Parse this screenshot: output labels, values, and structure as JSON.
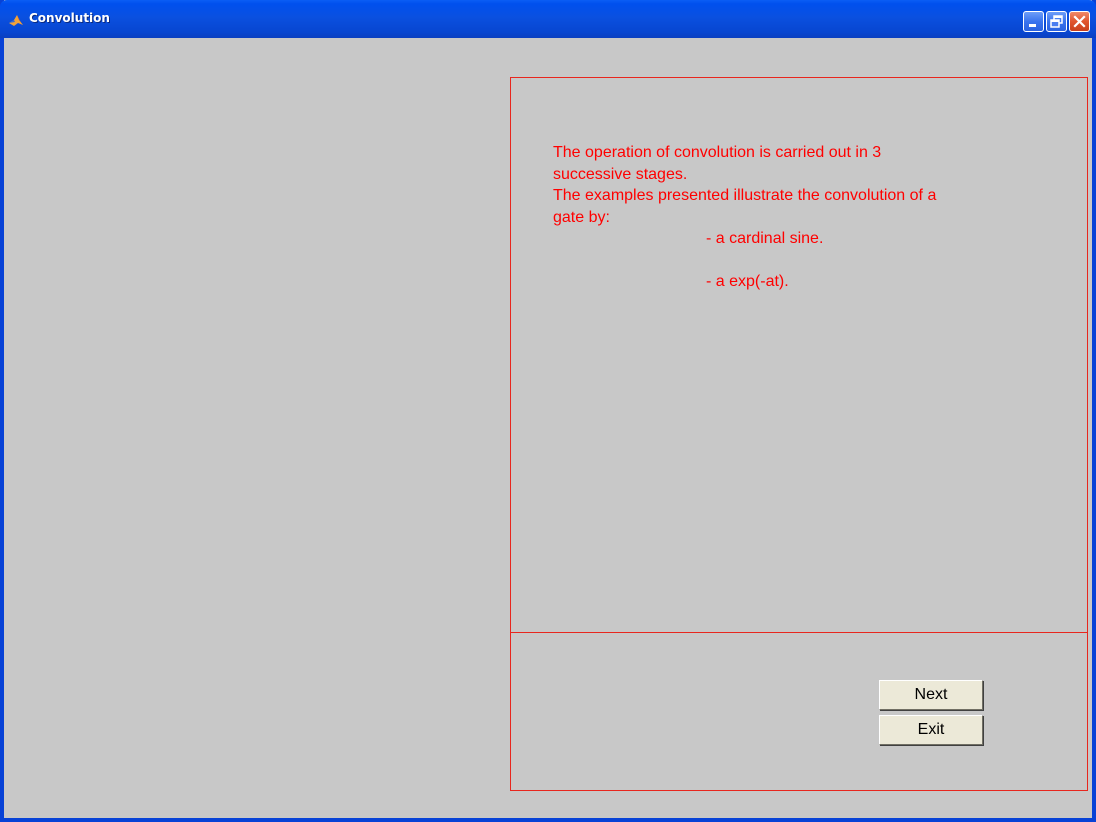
{
  "window": {
    "title": "Convolution",
    "icons": {
      "app": "matlab-logo-icon",
      "minimize": "minimize-icon",
      "maximize": "restore-icon",
      "close": "close-icon"
    }
  },
  "info": {
    "lines": [
      "The operation of convolution is carried out in 3",
      "successive stages.",
      "The examples presented illustrate the convolution of a",
      "gate by:"
    ],
    "bullets": [
      "- a cardinal sine.",
      "- a exp(-at)."
    ]
  },
  "buttons": {
    "next_label": "Next",
    "exit_label": "Exit"
  },
  "colors": {
    "text": "#ff0000",
    "panel_border": "#e8261e",
    "background": "#c8c8c8",
    "titlebar": "#0a50e0"
  }
}
